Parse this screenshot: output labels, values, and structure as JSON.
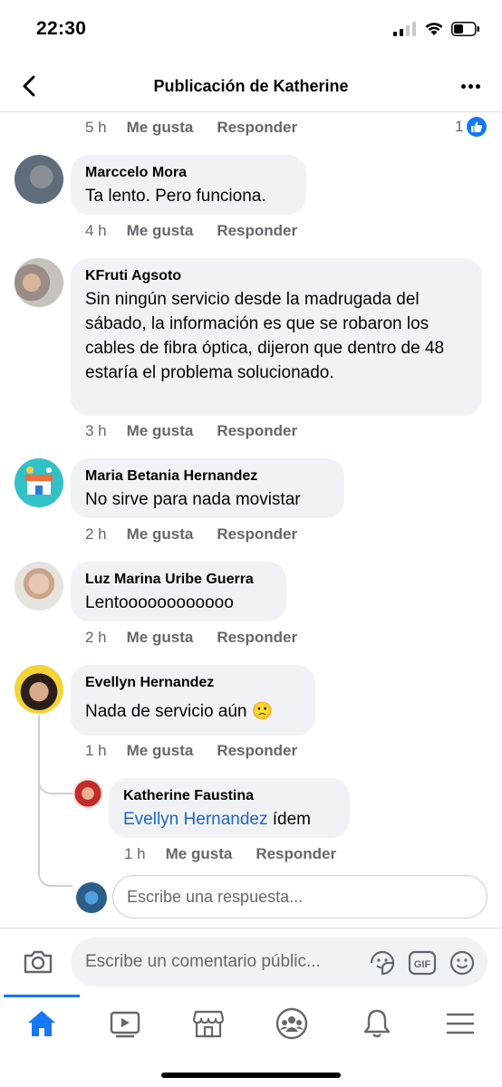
{
  "status_bar": {
    "time": "22:30"
  },
  "header": {
    "title": "Publicación de Katherine"
  },
  "top_meta": {
    "time": "5 h",
    "like": "Me gusta",
    "reply": "Responder",
    "reaction_count": "1"
  },
  "comments": [
    {
      "author": "Marccelo Mora",
      "text": "Ta lento. Pero funciona.",
      "time": "4 h",
      "like": "Me gusta",
      "reply": "Responder"
    },
    {
      "author": "KFruti Agsoto",
      "text": "Sin ningún servicio desde la madrugada del sábado,  la información es que se robaron los cables de fibra óptica, dijeron que dentro de 48 estaría el problema solucionado.",
      "time": "3 h",
      "like": "Me gusta",
      "reply": "Responder"
    },
    {
      "author": "Maria Betania Hernandez",
      "text": "No sirve para nada movistar",
      "time": "2 h",
      "like": "Me gusta",
      "reply": "Responder"
    },
    {
      "author": "Luz Marina Uribe Guerra",
      "text": "Lentoooooooooooo",
      "time": "2 h",
      "like": "Me gusta",
      "reply": "Responder"
    },
    {
      "author": "Evellyn Hernandez",
      "text": "Nada de servicio aún 🙁",
      "time": "1 h",
      "like": "Me gusta",
      "reply": "Responder"
    }
  ],
  "reply": {
    "author": "Katherine Faustina",
    "mention": "Evellyn Hernandez",
    "text": " ídem",
    "time": "1 h",
    "like": "Me gusta",
    "reply": "Responder"
  },
  "reply_input": {
    "placeholder": "Escribe una respuesta..."
  },
  "compose": {
    "placeholder": "Escribe un comentario públic...",
    "gif_label": "GIF"
  },
  "colors": {
    "accent": "#1877f2",
    "bubble": "#f0f2f5",
    "meta": "#65676b",
    "mention": "#1f65c4"
  },
  "icons": [
    "back-arrow-icon",
    "more-icon",
    "like-icon",
    "camera-icon",
    "sticker-icon",
    "gif-icon",
    "emoji-icon",
    "home-icon",
    "watch-icon",
    "marketplace-icon",
    "groups-icon",
    "notifications-icon",
    "menu-icon"
  ]
}
